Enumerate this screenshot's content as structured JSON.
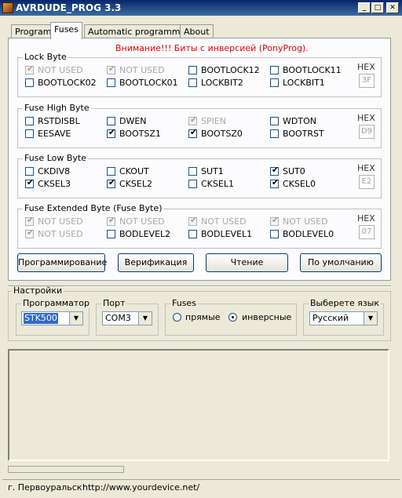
{
  "window": {
    "title": "AVRDUDE_PROG 3.3",
    "min": "_",
    "max": "□",
    "close": "✕"
  },
  "tabs": [
    "Program",
    "Fuses",
    "Automatic programming",
    "About"
  ],
  "warning": "Внимание!!! Биты с инверсией (PonyProg).",
  "hex_label": "HEX",
  "groups": [
    {
      "title": "Lock Byte",
      "hex": "3F",
      "items": [
        {
          "label": "NOT USED",
          "checked": true,
          "disabled": true
        },
        {
          "label": "NOT USED",
          "checked": true,
          "disabled": true
        },
        {
          "label": "BOOTLOCK12",
          "checked": false,
          "disabled": false
        },
        {
          "label": "BOOTLOCK11",
          "checked": false,
          "disabled": false
        },
        {
          "label": "BOOTLOCK02",
          "checked": false,
          "disabled": false
        },
        {
          "label": "BOOTLOCK01",
          "checked": false,
          "disabled": false
        },
        {
          "label": "LOCKBIT2",
          "checked": false,
          "disabled": false
        },
        {
          "label": "LOCKBIT1",
          "checked": false,
          "disabled": false
        }
      ]
    },
    {
      "title": "Fuse High Byte",
      "hex": "D9",
      "items": [
        {
          "label": "RSTDISBL",
          "checked": false,
          "disabled": false
        },
        {
          "label": "DWEN",
          "checked": false,
          "disabled": false
        },
        {
          "label": "SPIEN",
          "checked": true,
          "disabled": true
        },
        {
          "label": "WDTON",
          "checked": false,
          "disabled": false
        },
        {
          "label": "EESAVE",
          "checked": false,
          "disabled": false
        },
        {
          "label": "BOOTSZ1",
          "checked": true,
          "disabled": false
        },
        {
          "label": "BOOTSZ0",
          "checked": true,
          "disabled": false
        },
        {
          "label": "BOOTRST",
          "checked": false,
          "disabled": false
        }
      ]
    },
    {
      "title": "Fuse Low Byte",
      "hex": "E2",
      "items": [
        {
          "label": "CKDIV8",
          "checked": false,
          "disabled": false
        },
        {
          "label": "CKOUT",
          "checked": false,
          "disabled": false
        },
        {
          "label": "SUT1",
          "checked": false,
          "disabled": false
        },
        {
          "label": "SUT0",
          "checked": true,
          "disabled": false
        },
        {
          "label": "CKSEL3",
          "checked": true,
          "disabled": false
        },
        {
          "label": "CKSEL2",
          "checked": true,
          "disabled": false
        },
        {
          "label": "CKSEL1",
          "checked": false,
          "disabled": false
        },
        {
          "label": "CKSEL0",
          "checked": true,
          "disabled": false
        }
      ]
    },
    {
      "title": "Fuse Extended Byte (Fuse Byte)",
      "hex": "07",
      "items": [
        {
          "label": "NOT USED",
          "checked": true,
          "disabled": true
        },
        {
          "label": "NOT USED",
          "checked": true,
          "disabled": true
        },
        {
          "label": "NOT USED",
          "checked": true,
          "disabled": true
        },
        {
          "label": "NOT USED",
          "checked": true,
          "disabled": true
        },
        {
          "label": "NOT USED",
          "checked": true,
          "disabled": true
        },
        {
          "label": "BODLEVEL2",
          "checked": false,
          "disabled": false
        },
        {
          "label": "BODLEVEL1",
          "checked": false,
          "disabled": false
        },
        {
          "label": "BODLEVEL0",
          "checked": false,
          "disabled": false
        }
      ]
    }
  ],
  "buttons": [
    "Программирование",
    "Верификация",
    "Чтение",
    "По умолчанию"
  ],
  "settings": {
    "title": "Настройки",
    "programmer": {
      "label": "Программатор",
      "value": "STK500"
    },
    "port": {
      "label": "Порт",
      "value": "COM3"
    },
    "fuses": {
      "label": "Fuses",
      "opt1": "прямые",
      "opt2": "инверсные",
      "selected": "инверсные"
    },
    "language": {
      "label": "Выберете язык",
      "value": "Русский"
    }
  },
  "status": {
    "city": "г. Первоуральск",
    "url": "http://www.yourdevice.net/"
  }
}
